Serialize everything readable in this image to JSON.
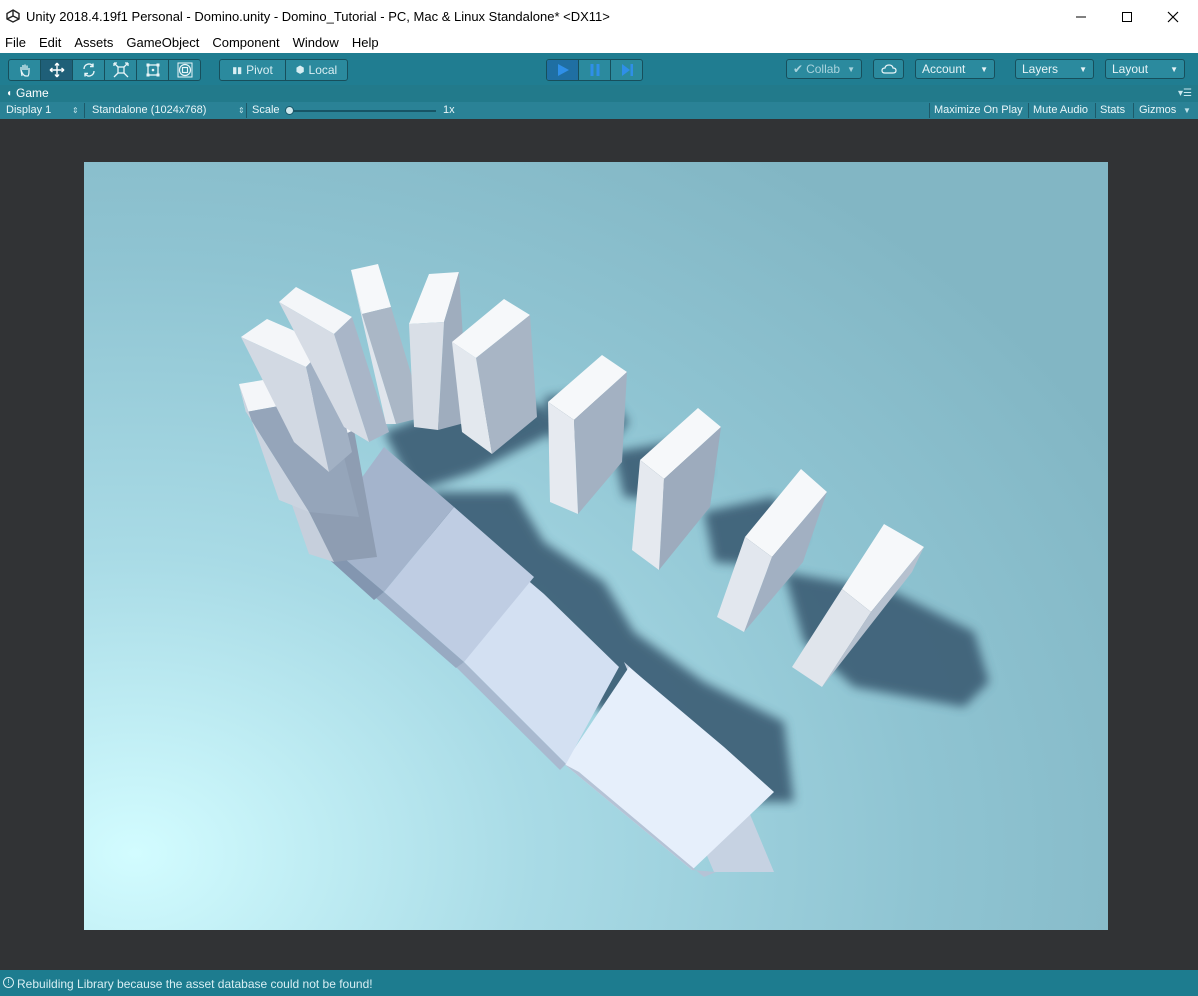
{
  "window": {
    "title": "Unity 2018.4.19f1 Personal - Domino.unity - Domino_Tutorial - PC, Mac & Linux Standalone* <DX11>"
  },
  "menu": [
    "File",
    "Edit",
    "Assets",
    "GameObject",
    "Component",
    "Window",
    "Help"
  ],
  "toolbar": {
    "pivot_label": "Pivot",
    "local_label": "Local",
    "collab_label": "Collab",
    "account_label": "Account",
    "layers_label": "Layers",
    "layout_label": "Layout"
  },
  "game_view": {
    "tab_label": "Game",
    "display": "Display 1",
    "resolution": "Standalone (1024x768)",
    "scale_label": "Scale",
    "scale_value": "1x",
    "scale_fraction": 0.0,
    "maximize_on_play": "Maximize On Play",
    "mute_audio": "Mute Audio",
    "stats": "Stats",
    "gizmos": "Gizmos"
  },
  "status": {
    "message": "Rebuilding Library because the asset database could not be found!"
  },
  "colors": {
    "toolbar": "#207d91",
    "play_active": "#2f8fe8",
    "scene_sky": "#8fc4d2",
    "domino_face": "#e8eef5",
    "shadow": "#3c5d74"
  }
}
